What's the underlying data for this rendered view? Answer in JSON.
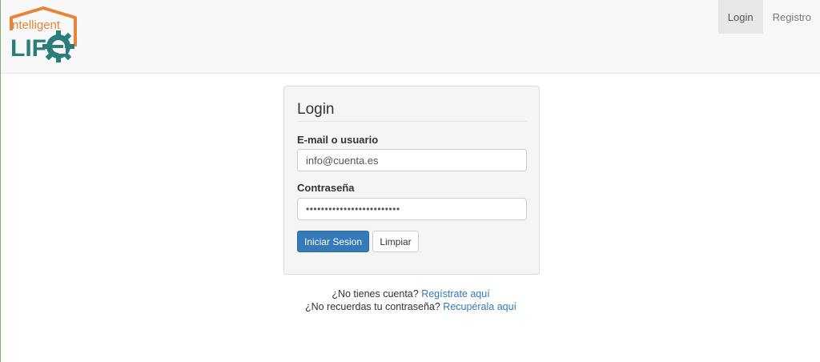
{
  "logo": {
    "text_top": "ntelligent",
    "text_bottom": "LIF",
    "colors": {
      "orange": "#e8843a",
      "teal": "#2a7d7b"
    }
  },
  "nav": {
    "login_label": "Login",
    "register_label": "Registro"
  },
  "panel": {
    "title": "Login",
    "email_label": "E-mail o usuario",
    "email_value": "info@cuenta.es",
    "password_label": "Contraseña",
    "password_value": "•••••••••••••••••••••••••",
    "submit_label": "Iniciar Sesion",
    "clear_label": "Limpiar"
  },
  "help": {
    "no_account_text": "¿No tienes cuenta?",
    "register_link": "Regístrate aquí",
    "forgot_text": "¿No recuerdas tu contraseña?",
    "recover_link": "Recupérala aquí"
  },
  "colors": {
    "primary": "#337ab7",
    "navbar_bg": "#f8f8f8",
    "panel_bg": "#f5f5f5"
  }
}
